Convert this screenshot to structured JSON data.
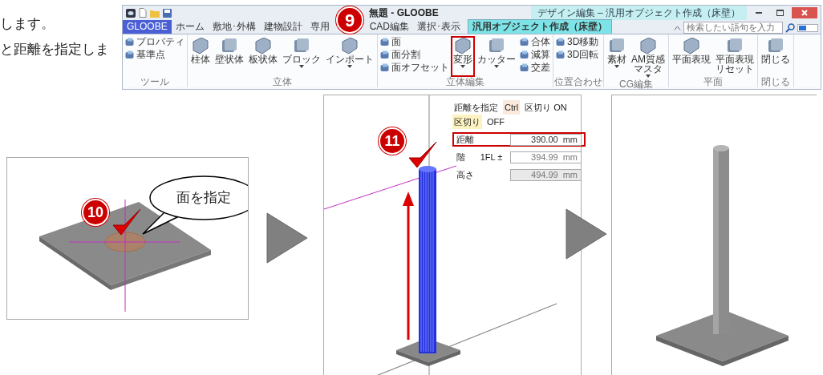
{
  "intro_lines": [
    "します。",
    "と距離を指定しま"
  ],
  "ribbon": {
    "title": "無題 - GLOOBE",
    "contextual_header": "デザイン編集 – 汎用オブジェクト作成（床壁）",
    "tabs": [
      {
        "label": "GLOOBE",
        "kind": "app",
        "selected": false
      },
      {
        "label": "ホーム",
        "kind": "normal",
        "selected": false
      },
      {
        "label": "敷地･外構",
        "kind": "normal",
        "selected": false
      },
      {
        "label": "建物設計",
        "kind": "normal",
        "selected": false
      },
      {
        "label": "専用",
        "kind": "normal",
        "selected": false
      },
      {
        "label": "CAD編集",
        "kind": "normal",
        "selected": false
      },
      {
        "label": "選択･表示",
        "kind": "normal",
        "selected": false
      },
      {
        "label": "汎用オブジェクト作成（床壁）",
        "kind": "contextual",
        "selected": true
      }
    ],
    "search": {
      "placeholder": "検索したい語句を入力"
    },
    "step_badge": "9",
    "groups": [
      {
        "label": "ツール",
        "items": [
          {
            "label": "プロパティ",
            "kind": "small"
          },
          {
            "label": "基準点",
            "kind": "small"
          }
        ]
      },
      {
        "label": "立体",
        "items": [
          {
            "label": "柱体",
            "kind": "large",
            "dropdown": false,
            "highlighted": false
          },
          {
            "label": "壁状体",
            "kind": "large",
            "dropdown": false,
            "highlighted": false
          },
          {
            "label": "板状体",
            "kind": "large",
            "dropdown": false,
            "highlighted": false
          },
          {
            "label": "ブロック",
            "kind": "large",
            "dropdown": true,
            "highlighted": false
          },
          {
            "label": "インポート",
            "kind": "large",
            "dropdown": true,
            "highlighted": false
          }
        ]
      },
      {
        "label": "立体編集",
        "items": [
          {
            "label": "面",
            "kind": "small"
          },
          {
            "label": "面分割",
            "kind": "small"
          },
          {
            "label": "面オフセット",
            "kind": "small"
          },
          {
            "label": "変形",
            "kind": "large",
            "dropdown": true,
            "highlighted": true
          },
          {
            "label": "カッター",
            "kind": "large",
            "dropdown": true,
            "highlighted": false
          },
          {
            "label": "合体",
            "kind": "small"
          },
          {
            "label": "減算",
            "kind": "small"
          },
          {
            "label": "交差",
            "kind": "small"
          }
        ]
      },
      {
        "label": "位置合わせ",
        "items": [
          {
            "label": "3D移動",
            "kind": "small"
          },
          {
            "label": "3D回転",
            "kind": "small"
          }
        ]
      },
      {
        "label": "CG編集",
        "items": [
          {
            "label": "素材",
            "kind": "large",
            "dropdown": true,
            "highlighted": false
          },
          {
            "label_lines": [
              "AM質感",
              "マスタ"
            ],
            "kind": "large",
            "dropdown": true,
            "highlighted": false
          }
        ]
      },
      {
        "label": "平面",
        "items": [
          {
            "label": "平面表現",
            "kind": "large",
            "dropdown": false,
            "highlighted": false
          },
          {
            "label_lines": [
              "平面表現",
              "リセット"
            ],
            "kind": "large",
            "dropdown": false,
            "highlighted": false
          }
        ]
      },
      {
        "label": "閉じる",
        "items": [
          {
            "label": "閉じる",
            "kind": "large",
            "dropdown": false,
            "highlighted": false
          }
        ]
      }
    ]
  },
  "step1": {
    "step_badge": "10",
    "callout": "面を指定"
  },
  "step2": {
    "step_badge": "11",
    "hint_lines": [
      [
        {
          "text": "距離を指定",
          "key": false
        },
        {
          "text": "Ctrl",
          "key": true
        },
        {
          "text": "区切り ON",
          "key": false
        }
      ],
      [
        {
          "text": "区切り",
          "key": true
        },
        {
          "text": "OFF",
          "key": false
        }
      ]
    ],
    "fields": [
      {
        "label": "距離",
        "value": "390.00",
        "unit": "mm",
        "highlighted": true,
        "disabled": false
      },
      {
        "label": "階",
        "extra": "1FL ±",
        "value": "394.99",
        "unit": "mm",
        "highlighted": false,
        "disabled": false
      },
      {
        "label": "高さ",
        "value": "494.99",
        "unit": "mm",
        "highlighted": false,
        "disabled": true
      }
    ]
  }
}
